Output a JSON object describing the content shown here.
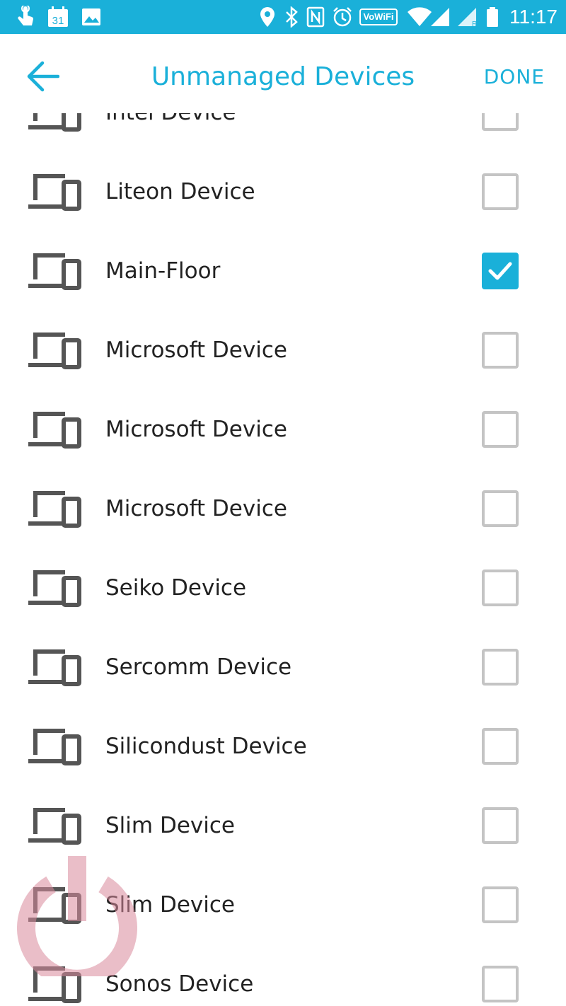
{
  "status_bar": {
    "time": "11:17",
    "calendar_day": "31",
    "vowifi_label": "VoWiFi",
    "icons": [
      "touch-icon",
      "calendar-icon",
      "image-icon",
      "location-icon",
      "bluetooth-icon",
      "nfc-icon",
      "alarm-icon",
      "vowifi-icon",
      "wifi-icon",
      "signal-icon",
      "signal-roaming-icon",
      "battery-icon"
    ]
  },
  "header": {
    "title": "Unmanaged Devices",
    "done_label": "DONE",
    "accent_color": "#1ab0d9"
  },
  "devices": [
    {
      "label": "Intel Device",
      "checked": false
    },
    {
      "label": "Liteon Device",
      "checked": false
    },
    {
      "label": "Main-Floor",
      "checked": true
    },
    {
      "label": "Microsoft Device",
      "checked": false
    },
    {
      "label": "Microsoft Device",
      "checked": false
    },
    {
      "label": "Microsoft Device",
      "checked": false
    },
    {
      "label": "Seiko Device",
      "checked": false
    },
    {
      "label": "Sercomm Device",
      "checked": false
    },
    {
      "label": "Silicondust Device",
      "checked": false
    },
    {
      "label": "Slim Device",
      "checked": false
    },
    {
      "label": "Slim Device",
      "checked": false
    },
    {
      "label": "Sonos Device",
      "checked": false
    }
  ]
}
